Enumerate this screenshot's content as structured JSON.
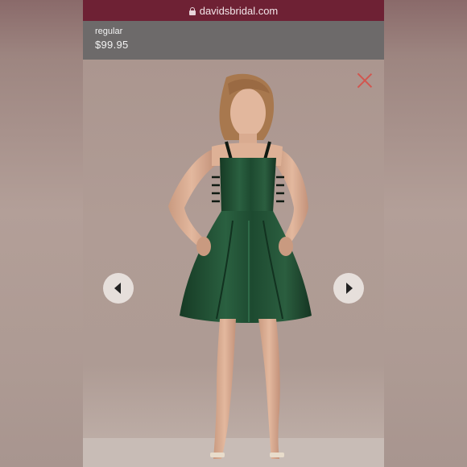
{
  "browser": {
    "url": "davidsbridal.com",
    "lock_icon": "lock-icon"
  },
  "product": {
    "price_label": "regular",
    "price": "$99.95",
    "dress_color": "#1f4a2e"
  },
  "gallery": {
    "close_icon": "close-icon",
    "prev_icon": "chevron-left-icon",
    "next_icon": "chevron-right-icon"
  },
  "colors": {
    "url_bar": "#6e2134",
    "price_bar": "#6d6a6a",
    "close_x": "#d2564f"
  }
}
